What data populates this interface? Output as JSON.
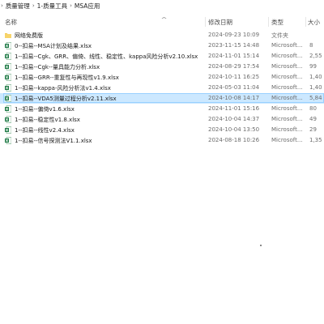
{
  "breadcrumb": {
    "items": [
      "质量管理",
      "1-质量工具",
      "MSA应用"
    ]
  },
  "columns": {
    "name": "名称",
    "date": "修改日期",
    "type": "类型",
    "size": "大小"
  },
  "files": [
    {
      "name": "网络免费版",
      "date": "2024-09-23 10:09",
      "type": "文件夹",
      "size": "",
      "icon": "folder-icon"
    },
    {
      "name": "0--扣易--MSA计划及结果.xlsx",
      "date": "2023-11-15 14:48",
      "type": "Microsoft...",
      "size": "8",
      "icon": "excel-icon"
    },
    {
      "name": "1--扣易--Cgk、GRR、偏倚、线性、稳定性、kappa风险分析v2.10.xlsx",
      "date": "2024-11-01 15:14",
      "type": "Microsoft...",
      "size": "2,55",
      "icon": "excel-icon"
    },
    {
      "name": "1--扣易--Cgk--量具能力分析.xlsx",
      "date": "2024-08-29 17:54",
      "type": "Microsoft...",
      "size": "99",
      "icon": "excel-icon"
    },
    {
      "name": "1--扣易--GRR--重复性与再现性v1.9.xlsx",
      "date": "2024-10-11 16:25",
      "type": "Microsoft...",
      "size": "1,40",
      "icon": "excel-icon"
    },
    {
      "name": "1--扣易--kappa-风险分析法v1.4.xlsx",
      "date": "2024-05-03 11:04",
      "type": "Microsoft...",
      "size": "1,40",
      "icon": "excel-icon"
    },
    {
      "name": "1--扣易--VDA5测量过程分析v2.11.xlsx",
      "date": "2024-10-08 14:17",
      "type": "Microsoft...",
      "size": "5,84",
      "icon": "excel-icon",
      "selected": true
    },
    {
      "name": "1--扣易--偏倚v1.6.xlsx",
      "date": "2024-11-01 15:16",
      "type": "Microsoft...",
      "size": "80",
      "icon": "excel-icon"
    },
    {
      "name": "1--扣易--稳定性v1.8.xlsx",
      "date": "2024-10-04 14:37",
      "type": "Microsoft...",
      "size": "49",
      "icon": "excel-icon"
    },
    {
      "name": "1--扣易--线性v2.4.xlsx",
      "date": "2024-10-04 13:50",
      "type": "Microsoft...",
      "size": "29",
      "icon": "excel-icon"
    },
    {
      "name": "1--扣易--信号探测法V1.1.xlsx",
      "date": "2024-08-18 10:26",
      "type": "Microsoft...",
      "size": "1,35",
      "icon": "excel-icon"
    }
  ],
  "colors": {
    "selected_bg": "#cce8ff",
    "selected_border": "#99d1ff",
    "folder": "#f2c94c",
    "excel": "#1d7a45"
  }
}
